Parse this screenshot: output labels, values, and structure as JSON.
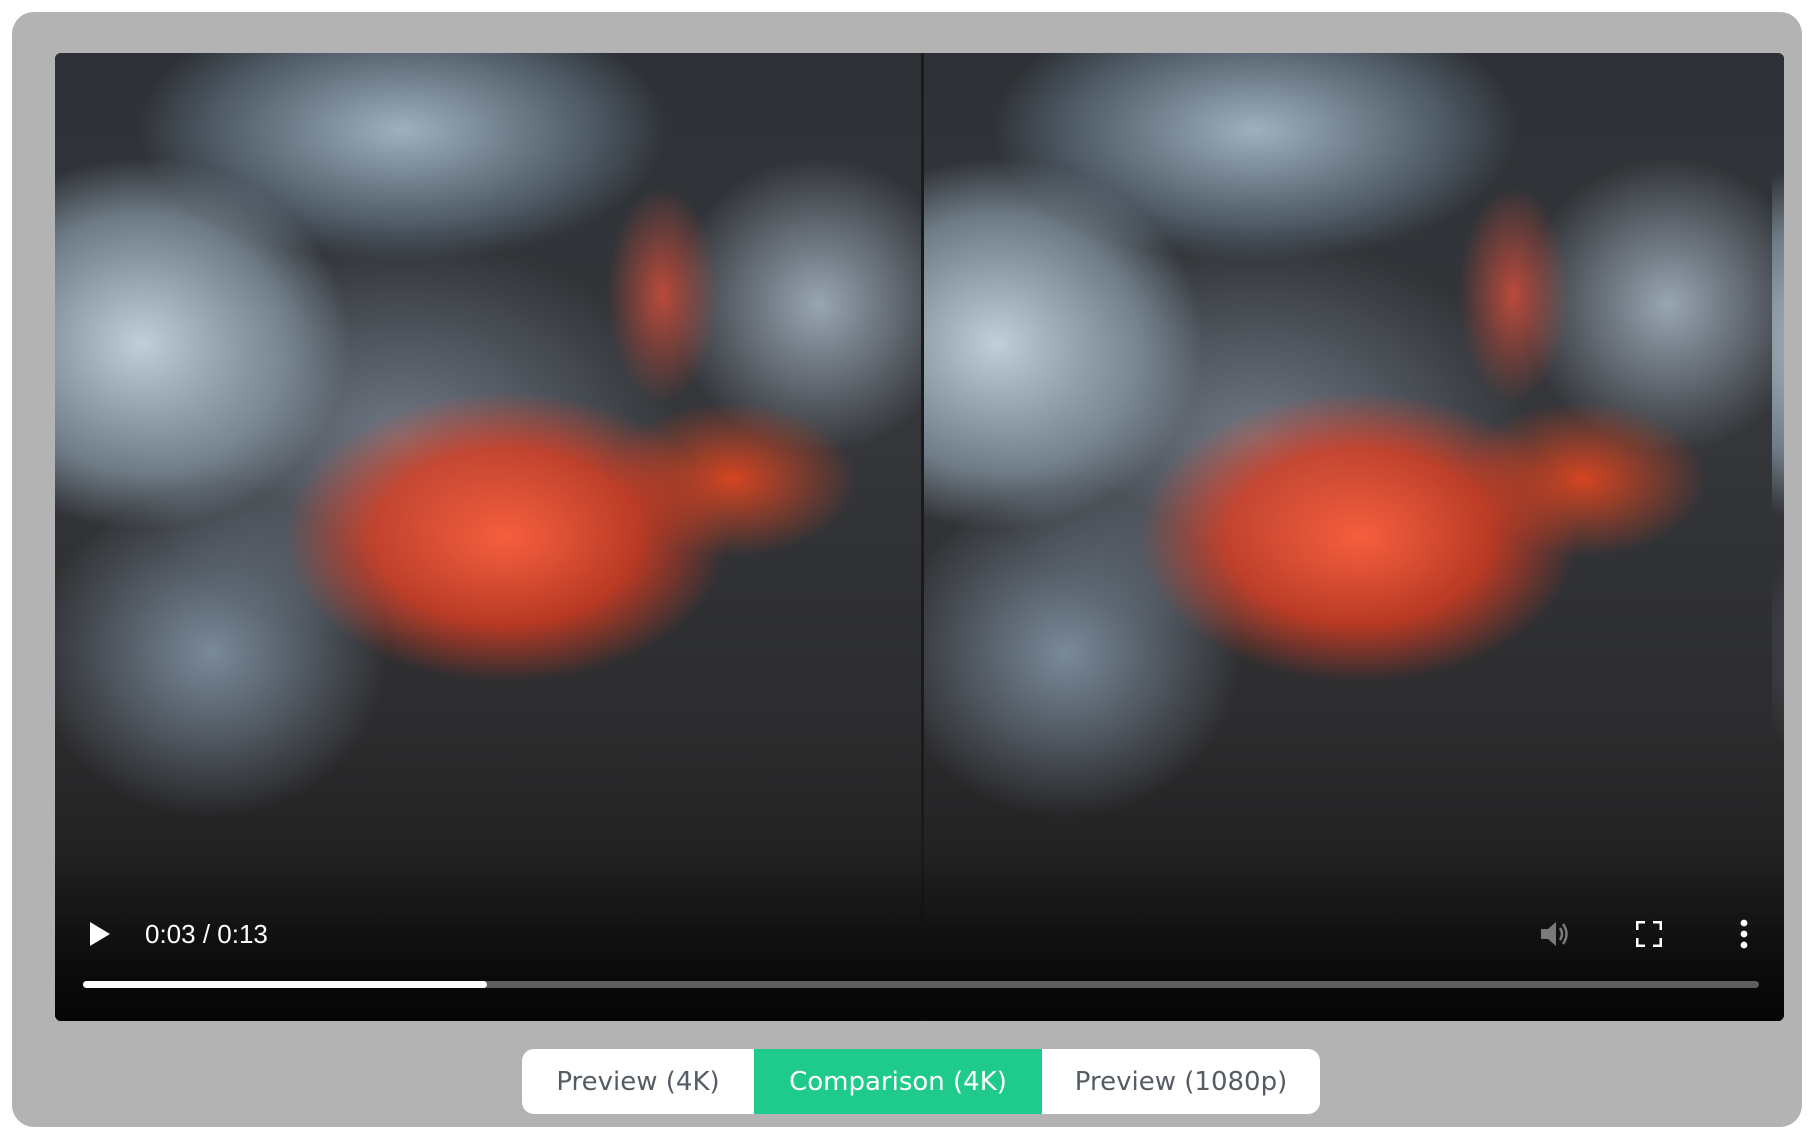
{
  "player": {
    "time_display": "0:03 / 0:13",
    "progress_fraction": 0.241,
    "icons": {
      "play": "play-icon",
      "volume": "volume-muted-icon",
      "fullscreen": "fullscreen-icon",
      "more": "more-vertical-icon"
    }
  },
  "tabs": [
    {
      "label": "Preview (4K)",
      "active": false
    },
    {
      "label": "Comparison (4K)",
      "active": true
    },
    {
      "label": "Preview (1080p)",
      "active": false
    }
  ],
  "colors": {
    "accent": "#1ecb8d",
    "frame": "#b3b3b3"
  }
}
